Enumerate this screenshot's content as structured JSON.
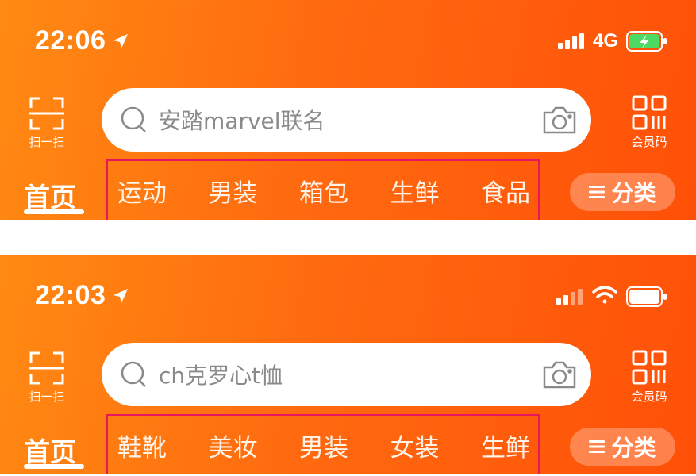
{
  "screens": [
    {
      "time": "22:06",
      "network": "4G",
      "connection_icon": "signal-bars-icon",
      "battery_icon": "battery-charging-icon",
      "scan_label": "扫一扫",
      "search_placeholder": "安踏marvel联名",
      "member_label": "会员码",
      "home_tab": "首页",
      "tabs": [
        "运动",
        "男装",
        "箱包",
        "生鲜",
        "食品"
      ],
      "category_button": "分类"
    },
    {
      "time": "22:03",
      "network": "",
      "connection_icon": "wifi-icon",
      "battery_icon": "battery-icon",
      "scan_label": "扫一扫",
      "search_placeholder": "ch克罗心t恤",
      "member_label": "会员码",
      "home_tab": "首页",
      "tabs": [
        "鞋靴",
        "美妆",
        "男装",
        "女装",
        "生鲜"
      ],
      "category_button": "分类"
    }
  ],
  "colors": {
    "header_start": "#ff8a12",
    "header_end": "#ff5008",
    "highlight_border": "#e8175d",
    "battery_charging": "#4cd964"
  }
}
